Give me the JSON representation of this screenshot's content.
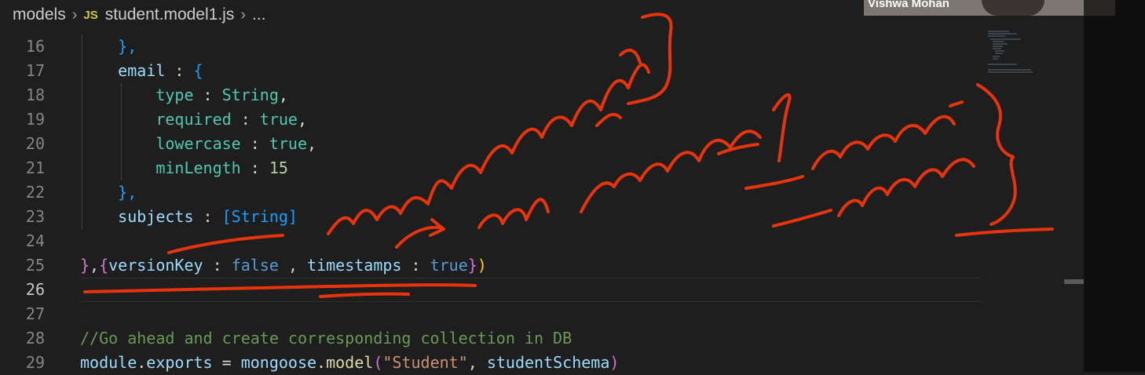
{
  "breadcrumb": {
    "folder": "models",
    "file_icon": "JS",
    "file": "student.model1.js",
    "more": "..."
  },
  "video_call": {
    "participant_name": "Vishwa Mohan"
  },
  "editor": {
    "active_line": 26,
    "lines": [
      {
        "n": "16",
        "tokens": [
          {
            "t": "    "
          },
          {
            "t": "},",
            "c": "br3"
          }
        ]
      },
      {
        "n": "17",
        "tokens": [
          {
            "t": "    "
          },
          {
            "t": "email",
            "c": "prop"
          },
          {
            "t": " : "
          },
          {
            "t": "{",
            "c": "br3"
          }
        ]
      },
      {
        "n": "18",
        "tokens": [
          {
            "t": "        "
          },
          {
            "t": "type",
            "c": "type"
          },
          {
            "t": " : "
          },
          {
            "t": "String",
            "c": "type"
          },
          {
            "t": ","
          }
        ]
      },
      {
        "n": "19",
        "tokens": [
          {
            "t": "        "
          },
          {
            "t": "required",
            "c": "type"
          },
          {
            "t": " : "
          },
          {
            "t": "true",
            "c": "type"
          },
          {
            "t": ","
          }
        ]
      },
      {
        "n": "20",
        "tokens": [
          {
            "t": "        "
          },
          {
            "t": "lowercase",
            "c": "type"
          },
          {
            "t": " : "
          },
          {
            "t": "true",
            "c": "type"
          },
          {
            "t": ","
          }
        ]
      },
      {
        "n": "21",
        "tokens": [
          {
            "t": "        "
          },
          {
            "t": "minLength",
            "c": "type"
          },
          {
            "t": " : "
          },
          {
            "t": "15",
            "c": "num"
          }
        ]
      },
      {
        "n": "22",
        "tokens": [
          {
            "t": "    "
          },
          {
            "t": "},",
            "c": "br3"
          }
        ]
      },
      {
        "n": "23",
        "tokens": [
          {
            "t": "    "
          },
          {
            "t": "subjects",
            "c": "prop"
          },
          {
            "t": " : "
          },
          {
            "t": "[String]",
            "c": "br3"
          }
        ]
      },
      {
        "n": "24",
        "tokens": []
      },
      {
        "n": "25",
        "tokens": [
          {
            "t": "}",
            "c": "br1"
          },
          {
            "t": ","
          },
          {
            "t": "{",
            "c": "br1"
          },
          {
            "t": "versionKey",
            "c": "prop"
          },
          {
            "t": " : "
          },
          {
            "t": "false",
            "c": "kw"
          },
          {
            "t": " , "
          },
          {
            "t": "timestamps",
            "c": "prop"
          },
          {
            "t": " : "
          },
          {
            "t": "true",
            "c": "kw"
          },
          {
            "t": "}",
            "c": "br1"
          },
          {
            "t": ")",
            "c": "br2"
          }
        ]
      },
      {
        "n": "26",
        "tokens": []
      },
      {
        "n": "27",
        "tokens": []
      },
      {
        "n": "28",
        "tokens": [
          {
            "t": "//Go ahead and create corresponding collection in DB",
            "c": "cmt"
          }
        ]
      },
      {
        "n": "29",
        "tokens": [
          {
            "t": "module",
            "c": "prop"
          },
          {
            "t": "."
          },
          {
            "t": "exports",
            "c": "prop"
          },
          {
            "t": " = "
          },
          {
            "t": "mongoose",
            "c": "prop"
          },
          {
            "t": "."
          },
          {
            "t": "model",
            "c": "fn"
          },
          {
            "t": "(",
            "c": "br1"
          },
          {
            "t": "\"Student\"",
            "c": "str"
          },
          {
            "t": ", "
          },
          {
            "t": "studentSchema",
            "c": "prop"
          },
          {
            "t": ")",
            "c": "br1"
          }
        ]
      }
    ]
  },
  "colors": {
    "background": "#1e1e1e",
    "annotation_ink": "#e8340c"
  }
}
